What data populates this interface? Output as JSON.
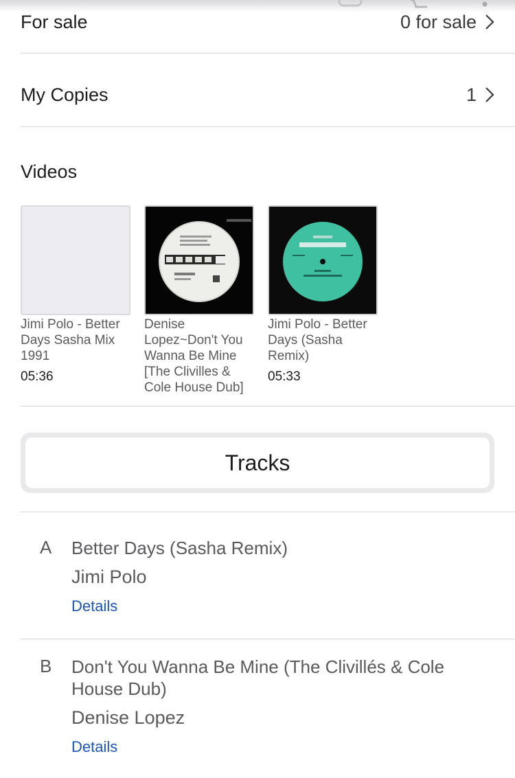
{
  "for_sale": {
    "label": "For sale",
    "value": "0 for sale"
  },
  "my_copies": {
    "label": "My Copies",
    "value": "1"
  },
  "videos": {
    "title": "Videos",
    "items": [
      {
        "title": "Jimi Polo - Better Days Sasha Mix 1991",
        "duration": "05:36"
      },
      {
        "title": "Denise Lopez~Don't You Wanna Be Mine [The Clivilles & Cole House Dub]",
        "duration": ""
      },
      {
        "title": "Jimi Polo - Better Days (Sasha Remix)",
        "duration": "05:33"
      }
    ]
  },
  "tracks_button": {
    "label": "Tracks"
  },
  "tracks": [
    {
      "position": "A",
      "title": "Better Days (Sasha Remix)",
      "artist": "Jimi Polo",
      "link": "Details"
    },
    {
      "position": "B",
      "title": "Don't You Wanna Be Mine (The Clivillés & Cole House Dub)",
      "artist": "Denise Lopez",
      "link": "Details"
    }
  ],
  "colors": {
    "link": "#1a55b8",
    "divider": "#d4d4d8",
    "label_record_teal": "#3fc0a0"
  }
}
